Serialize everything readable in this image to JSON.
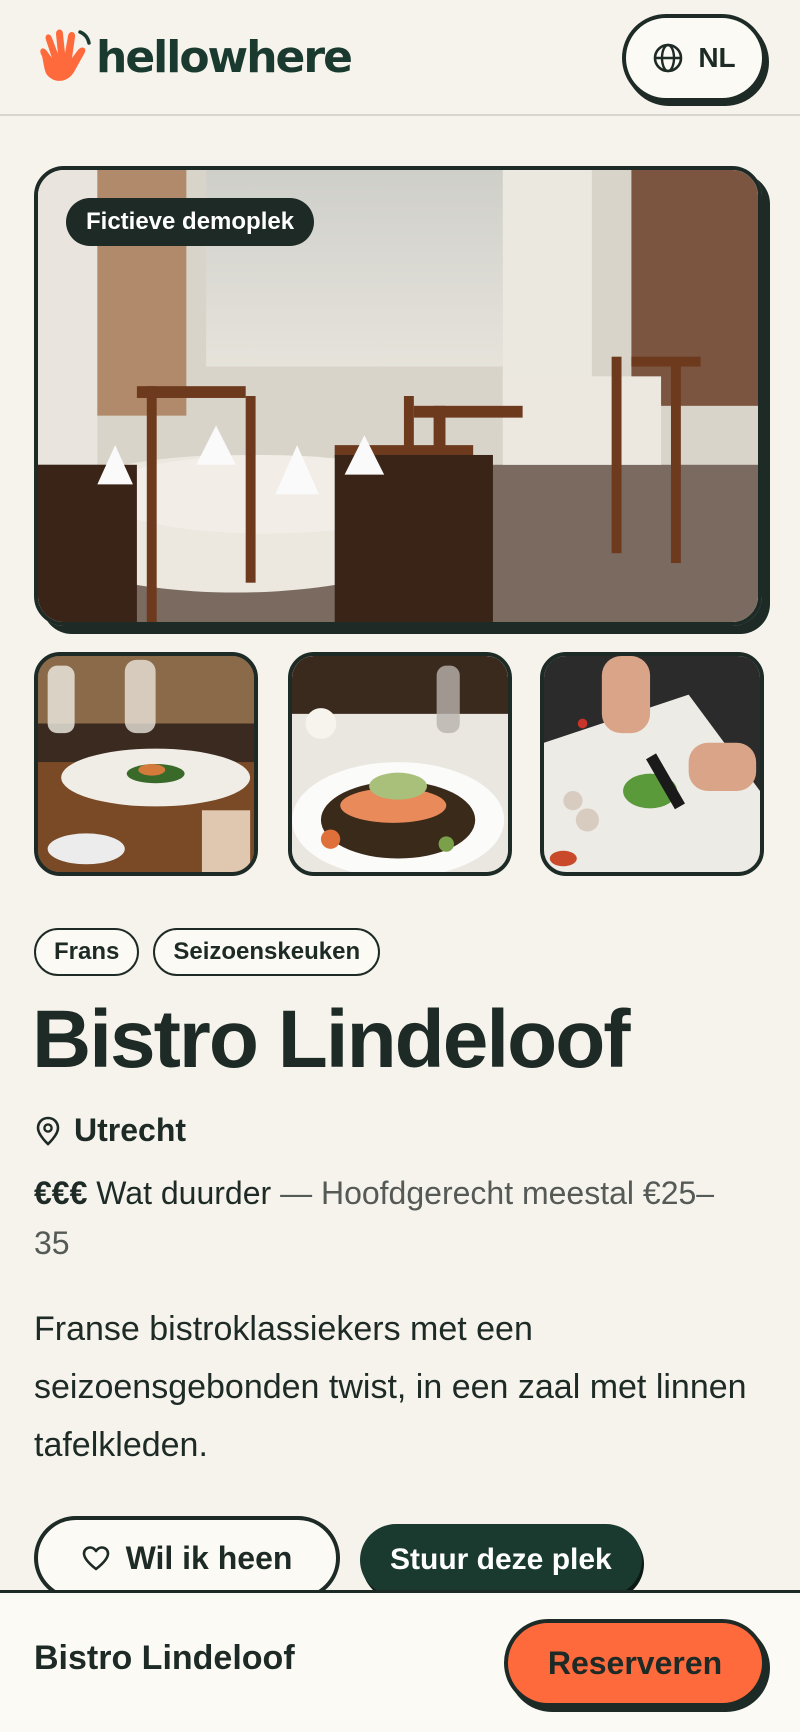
{
  "brand": {
    "name": "hellowhere",
    "icon": "waving-hand-logo",
    "accent": "#ff6a3d",
    "dark": "#1a3a30"
  },
  "header": {
    "language_label": "NL",
    "language_icon": "globe-icon"
  },
  "gallery": {
    "badge": "Fictieve demoplek",
    "hero_image": "restaurant-dining-room",
    "thumbnails": [
      "plated-dish-table",
      "salmon-dish",
      "chef-chopping-herbs"
    ]
  },
  "tags": [
    "Frans",
    "Seizoenskeuken"
  ],
  "restaurant": {
    "name": "Bistro Lindeloof",
    "location": "Utrecht",
    "price_symbol": "€€€",
    "price_label": "Wat duurder",
    "price_range": "— Hoofdgerecht meestal €25–35",
    "description": "Franse bistroklassiekers met een seizoensgebonden twist, in een zaal met linnen tafelkleden."
  },
  "actions": {
    "wishlist_label": "Wil ik heen",
    "share_label": "Stuur deze plek"
  },
  "bottom_bar": {
    "name": "Bistro Lindeloof",
    "reserve_label": "Reserveren"
  }
}
